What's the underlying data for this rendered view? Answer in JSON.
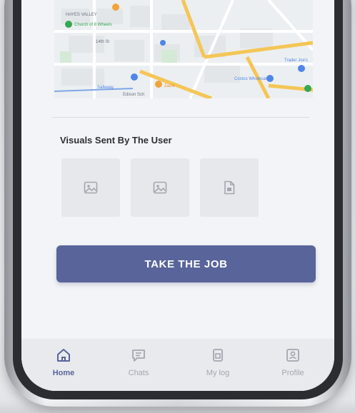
{
  "visuals": {
    "title": "Visuals Sent By The User",
    "items": [
      {
        "icon": "image-icon"
      },
      {
        "icon": "image-icon"
      },
      {
        "icon": "document-icon"
      }
    ]
  },
  "cta": {
    "label": "TAKE THE JOB"
  },
  "tabs": [
    {
      "label": "Home",
      "icon": "home-icon",
      "active": true
    },
    {
      "label": "Chats",
      "icon": "chat-icon",
      "active": false
    },
    {
      "label": "My log",
      "icon": "log-icon",
      "active": false
    },
    {
      "label": "Profile",
      "icon": "profile-icon",
      "active": false
    }
  ],
  "colors": {
    "accent": "#59649a",
    "inactive": "#a3a6b0",
    "background": "#f3f4f7"
  },
  "map": {
    "labels": {
      "area": "HAYES VALLEY",
      "church": "Church of 8 Wheels",
      "store": "Costco Wholesale",
      "trader": "Trader Joe's",
      "safeway": "Safeway",
      "school": "Edison Sch",
      "restaurant": "Zazie",
      "street": "14th St"
    }
  }
}
